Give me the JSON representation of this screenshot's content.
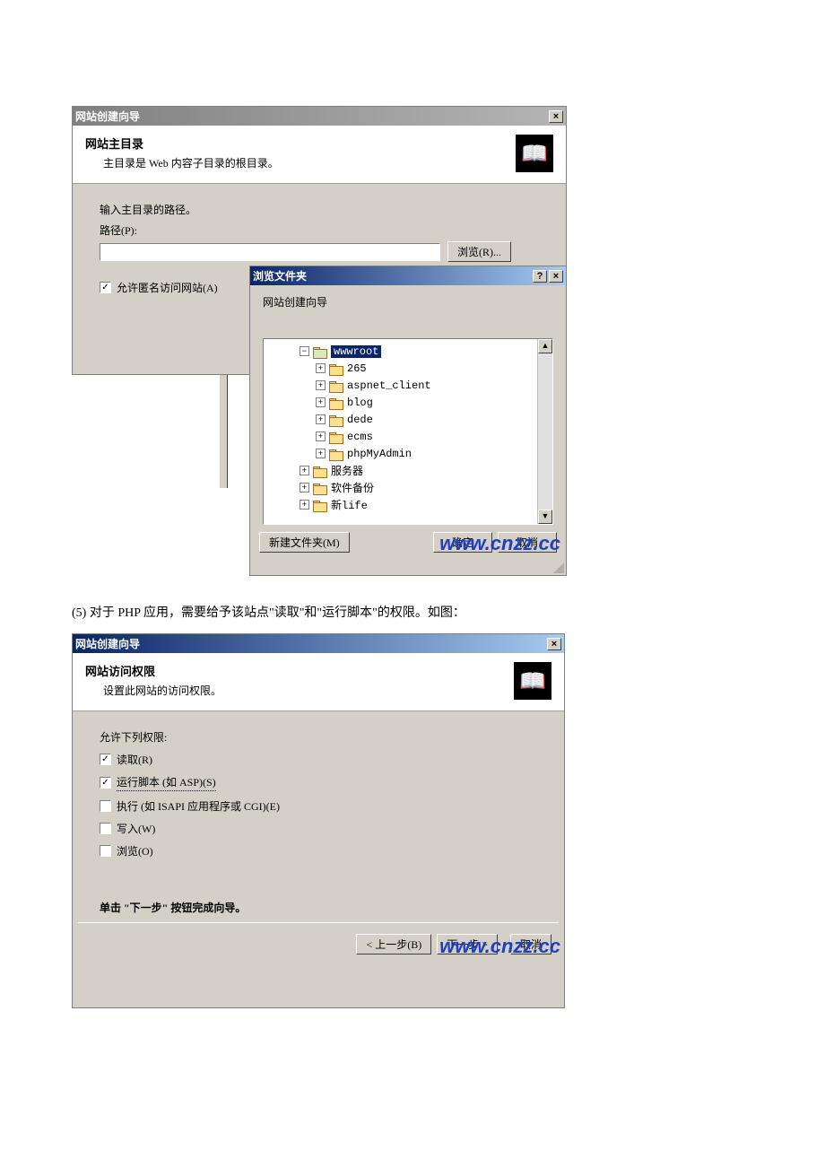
{
  "stack1": {
    "wizard": {
      "title": "网站创建向导",
      "close": "×",
      "header_title": "网站主目录",
      "header_sub": "主目录是 Web 内容子目录的根目录。",
      "prompt": "输入主目录的路径。",
      "path_label": "路径(P):",
      "path_value": "",
      "browse_btn": "浏览(R)...",
      "anon_checkbox": "允许匿名访问网站(A)"
    },
    "browse": {
      "title": "浏览文件夹",
      "help": "?",
      "close": "×",
      "subtitle": "网站创建向导",
      "tree": {
        "root": {
          "label": "wwwroot",
          "glyph": "−"
        },
        "children": [
          {
            "label": "265"
          },
          {
            "label": "aspnet_client"
          },
          {
            "label": "blog"
          },
          {
            "label": "dede"
          },
          {
            "label": "ecms"
          },
          {
            "label": "phpMyAdmin"
          }
        ],
        "siblings": [
          {
            "label": "服务器"
          },
          {
            "label": "软件备份"
          },
          {
            "label": "新life"
          },
          {
            "label": "…"
          }
        ]
      },
      "new_folder": "新建文件夹(M)",
      "ok": "确定",
      "cancel": "取消"
    },
    "watermark": "www.cnzz.cc"
  },
  "caption": "(5) 对于 PHP 应用，需要给予该站点\"读取\"和\"运行脚本\"的权限。如图：",
  "win2": {
    "title": "网站创建向导",
    "close": "×",
    "header_title": "网站访问权限",
    "header_sub": "设置此网站的访问权限。",
    "allow_label": "允许下列权限:",
    "perms": [
      {
        "checked": true,
        "label": "读取(R)"
      },
      {
        "checked": true,
        "label": "运行脚本 (如 ASP)(S)",
        "dotted": true
      },
      {
        "checked": false,
        "label": "执行 (如 ISAPI 应用程序或 CGI)(E)"
      },
      {
        "checked": false,
        "label": "写入(W)"
      },
      {
        "checked": false,
        "label": "浏览(O)"
      }
    ],
    "hint": "单击 \"下一步\" 按钮完成向导。",
    "prev": "< 上一步(B)",
    "next": "下一步 >",
    "cancel": "取消",
    "watermark": "www.cnzz.cc"
  }
}
